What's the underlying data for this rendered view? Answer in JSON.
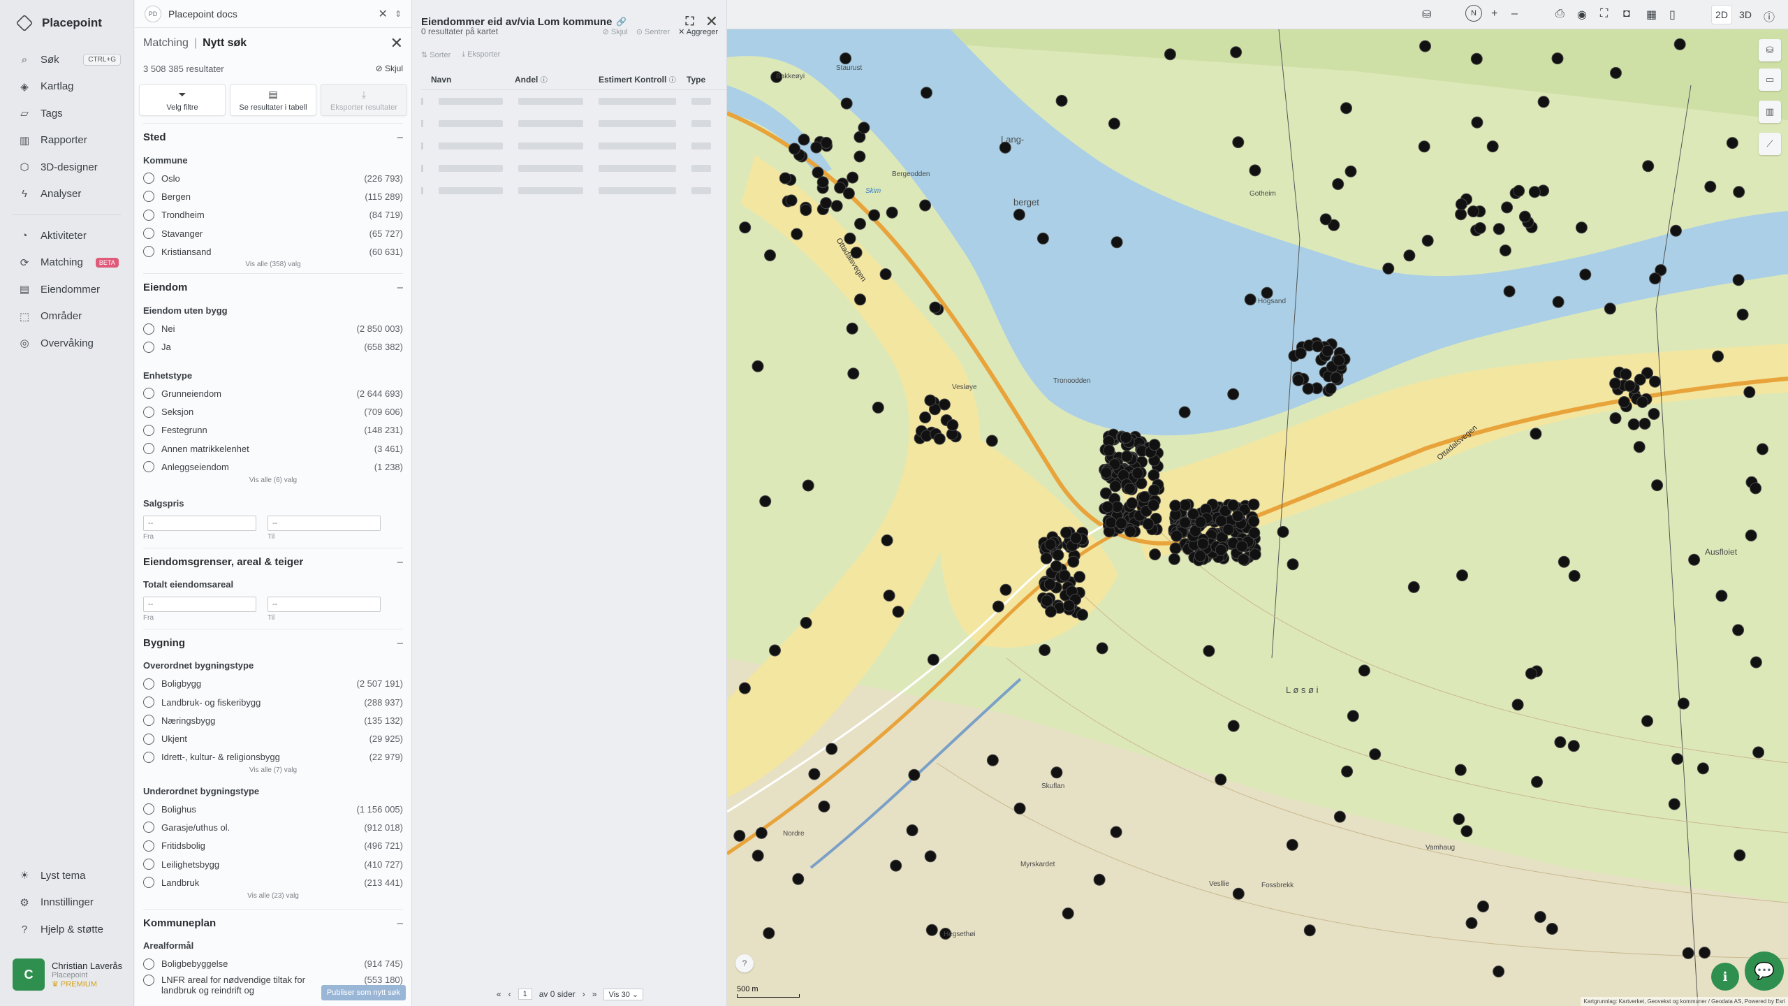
{
  "nav": {
    "brand": "Placepoint",
    "items": [
      {
        "label": "Søk",
        "kbd": "CTRL+G",
        "icon": "search-icon"
      },
      {
        "label": "Kartlag",
        "icon": "layers-icon"
      },
      {
        "label": "Tags",
        "icon": "bookmark-icon"
      },
      {
        "label": "Rapporter",
        "icon": "chart-icon"
      },
      {
        "label": "3D-designer",
        "icon": "cube-icon"
      },
      {
        "label": "Analyser",
        "icon": "bolt-icon"
      }
    ],
    "items2": [
      {
        "label": "Aktiviteter",
        "icon": "activity-icon"
      },
      {
        "label": "Matching",
        "badge": "BETA",
        "icon": "matching-icon"
      },
      {
        "label": "Eiendommer",
        "icon": "property-icon"
      },
      {
        "label": "Områder",
        "icon": "area-icon"
      },
      {
        "label": "Overvåking",
        "icon": "monitor-icon"
      }
    ],
    "bottom": [
      {
        "label": "Lyst tema",
        "icon": "sun-icon"
      },
      {
        "label": "Innstillinger",
        "icon": "gear-icon"
      },
      {
        "label": "Hjelp & støtte",
        "icon": "help-icon"
      }
    ],
    "user": {
      "initial": "C",
      "name": "Christian Laverås",
      "org": "Placepoint",
      "tier": "PREMIUM"
    }
  },
  "datasource": {
    "badge": "PD",
    "name": "Placepoint docs"
  },
  "filters": {
    "crumb": "Matching",
    "current": "Nytt søk",
    "count": "3 508 385 resultater",
    "hide_label": "Skjul",
    "actions": [
      "Velg filtre",
      "Se resultater i tabell",
      "Eksporter resultater"
    ],
    "publish": "Publiser som nytt søk",
    "sted": {
      "title": "Sted",
      "group": "Kommune",
      "options": [
        {
          "label": "Oslo",
          "count": "(226 793)"
        },
        {
          "label": "Bergen",
          "count": "(115 289)"
        },
        {
          "label": "Trondheim",
          "count": "(84 719)"
        },
        {
          "label": "Stavanger",
          "count": "(65 727)"
        },
        {
          "label": "Kristiansand",
          "count": "(60 631)"
        }
      ],
      "showall": "Vis alle (358) valg"
    },
    "eiendom": {
      "title": "Eiendom",
      "group1": "Eiendom uten bygg",
      "options1": [
        {
          "label": "Nei",
          "count": "(2 850 003)"
        },
        {
          "label": "Ja",
          "count": "(658 382)"
        }
      ],
      "group2": "Enhetstype",
      "options2": [
        {
          "label": "Grunneiendom",
          "count": "(2 644 693)"
        },
        {
          "label": "Seksjon",
          "count": "(709 606)"
        },
        {
          "label": "Festegrunn",
          "count": "(148 231)"
        },
        {
          "label": "Annen matrikkelenhet",
          "count": "(3 461)"
        },
        {
          "label": "Anleggseiendom",
          "count": "(1 238)"
        }
      ],
      "showall2": "Vis alle (6) valg",
      "group3": "Salgspris",
      "from": "Fra",
      "to": "Til",
      "placeholder": "--"
    },
    "grenser": {
      "title": "Eiendomsgrenser, areal & teiger",
      "group": "Totalt eiendomsareal",
      "from": "Fra",
      "to": "Til",
      "placeholder": "--"
    },
    "bygning": {
      "title": "Bygning",
      "group1": "Overordnet bygningstype",
      "options1": [
        {
          "label": "Boligbygg",
          "count": "(2 507 191)"
        },
        {
          "label": "Landbruk- og fiskeribygg",
          "count": "(288 937)"
        },
        {
          "label": "Næringsbygg",
          "count": "(135 132)"
        },
        {
          "label": "Ukjent",
          "count": "(29 925)"
        },
        {
          "label": "Idrett-, kultur- & religionsbygg",
          "count": "(22 979)"
        }
      ],
      "showall1": "Vis alle (7) valg",
      "group2": "Underordnet bygningstype",
      "options2": [
        {
          "label": "Bolighus",
          "count": "(1 156 005)"
        },
        {
          "label": "Garasje/uthus ol.",
          "count": "(912 018)"
        },
        {
          "label": "Fritidsbolig",
          "count": "(496 721)"
        },
        {
          "label": "Leilighetsbygg",
          "count": "(410 727)"
        },
        {
          "label": "Landbruk",
          "count": "(213 441)"
        }
      ],
      "showall2": "Vis alle (23) valg"
    },
    "kommuneplan": {
      "title": "Kommuneplan",
      "group": "Arealformål",
      "options": [
        {
          "label": "Boligbebyggelse",
          "count": "(914 745)"
        },
        {
          "label": "LNFR areal for nødvendige tiltak for landbruk og reindrift og",
          "count": "(553 180)"
        }
      ]
    }
  },
  "results": {
    "title": "Eiendommer eid av/via Lom kommune",
    "count": "0 resultater på kartet",
    "hide": "Skjul",
    "center": "Sentrer",
    "aggregate": "Aggreger",
    "sort": "Sorter",
    "export": "Eksporter",
    "columns": [
      "Navn",
      "Andel",
      "Estimert Kontroll",
      "Type"
    ],
    "pager": {
      "page": "1",
      "of": "av 0 sider",
      "per": "Vis 30"
    }
  },
  "map": {
    "mode_2d": "2D",
    "mode_3d": "3D",
    "scale": "500 m",
    "attribution": "Kartgrunnlag: Kartverket, Geovekst og kommuner / Geodata AS, Powered by Esri",
    "labels": {
      "skim": "Skim",
      "ottadal1": "Ottadalsvegen",
      "ottadal2": "Ottadalsvegen",
      "vesloye": "Vesløye",
      "berget": "berget",
      "lang": "Lang-",
      "losoi": "L ø s ø i",
      "staurust": "Staurust",
      "bakkeoyi": "Bakkeøyi",
      "bergeodden": "Bergeodden",
      "tronoodden": "Tronoodden",
      "gotheim": "Gotheim",
      "nordre": "Nordre",
      "hogsand": "Hogsand",
      "fossbrekk": "Fossbrekk",
      "hegsethoi": "Hegsethøi",
      "skuflan": "Skuflan",
      "mysskardet": "Myrskardet",
      "vesllie": "Vesllie",
      "vamhaug": "Vamhaug",
      "ausfloiet": "Ausfloiet"
    }
  }
}
